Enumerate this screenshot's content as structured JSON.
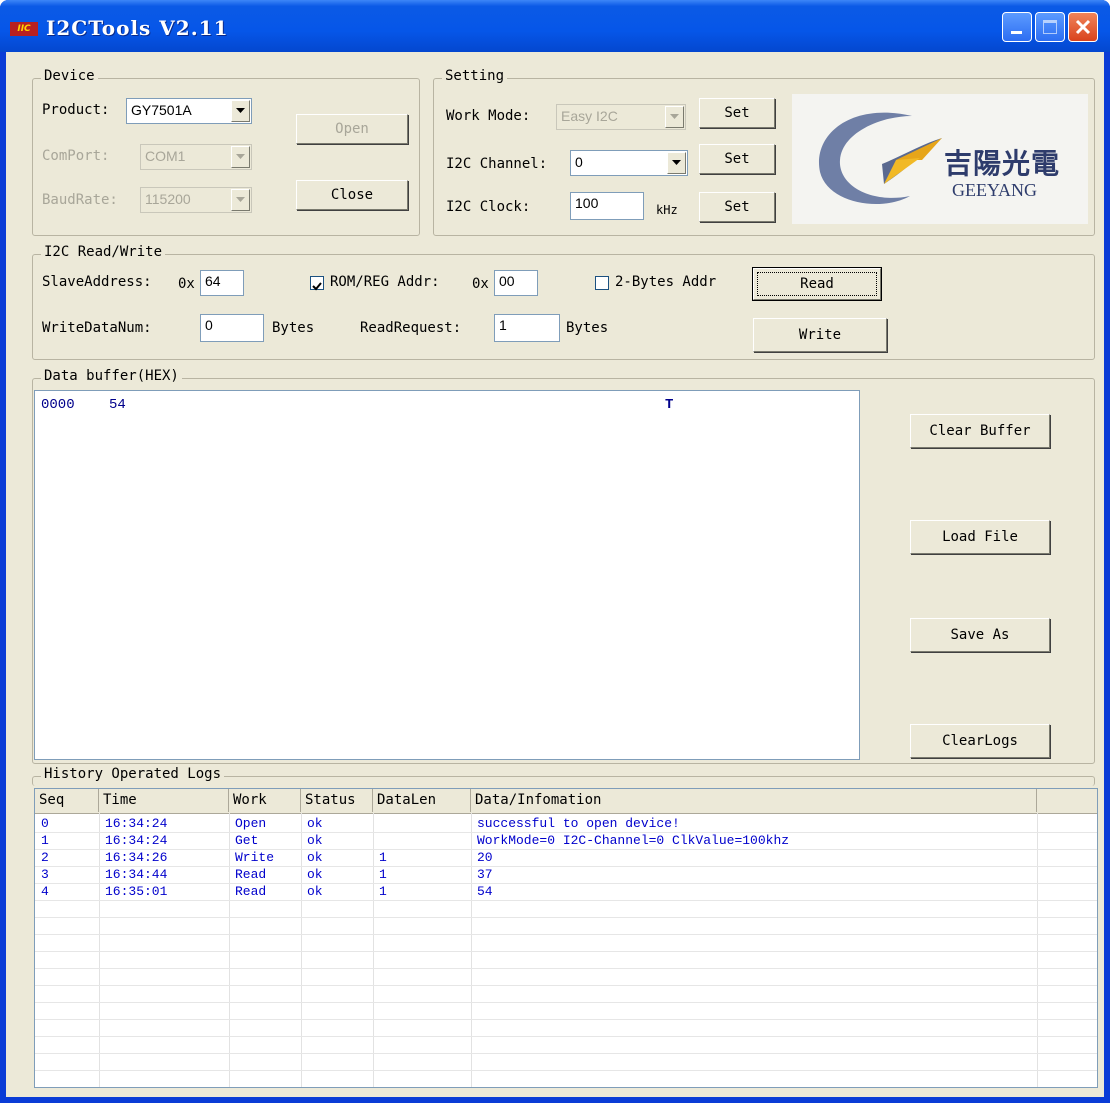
{
  "window": {
    "title": "I2CTools  V2.11",
    "icon_text": "IIC"
  },
  "device": {
    "legend": "Device",
    "product_label": "Product:",
    "product_value": "GY7501A",
    "comport_label": "ComPort:",
    "comport_value": "COM1",
    "baudrate_label": "BaudRate:",
    "baudrate_value": "115200",
    "open_label": "Open",
    "close_label": "Close"
  },
  "setting": {
    "legend": "Setting",
    "workmode_label": "Work Mode:",
    "workmode_value": "Easy I2C",
    "channel_label": "I2C Channel:",
    "channel_value": "0",
    "clock_label": "I2C Clock:",
    "clock_value": "100",
    "clock_unit": "kHz",
    "set_label": "Set"
  },
  "logo": {
    "cn_text": "吉陽光電",
    "en_text": "GEEYANG"
  },
  "rw": {
    "legend": "I2C Read/Write",
    "slave_label": "SlaveAddress:",
    "hex_prefix": "0x",
    "slave_value": "64",
    "romreg_label": "ROM/REG Addr:",
    "romreg_checked": true,
    "romreg_value": "00",
    "twobyte_label": "2-Bytes Addr",
    "twobyte_checked": false,
    "read_label": "Read",
    "write_label": "Write",
    "writenum_label": "WriteDataNum:",
    "writenum_value": "0",
    "bytes_label": "Bytes",
    "readreq_label": "ReadRequest:",
    "readreq_value": "1"
  },
  "buffer": {
    "legend": "Data buffer(HEX)",
    "addr": "0000",
    "hex": "54",
    "ascii": "T",
    "clear_buffer_label": "Clear Buffer",
    "load_file_label": "Load File",
    "save_as_label": "Save As",
    "clear_logs_label": "ClearLogs"
  },
  "logs": {
    "legend": "History Operated Logs",
    "columns": [
      "Seq",
      "Time",
      "Work",
      "Status",
      "DataLen",
      "Data/Infomation"
    ],
    "rows": [
      {
        "seq": "0",
        "time": "16:34:24",
        "work": "Open",
        "status": "ok",
        "len": "",
        "info": "successful to open device!"
      },
      {
        "seq": "1",
        "time": "16:34:24",
        "work": "Get",
        "status": "ok",
        "len": "",
        "info": "WorkMode=0 I2C-Channel=0 ClkValue=100khz"
      },
      {
        "seq": "2",
        "time": "16:34:26",
        "work": "Write",
        "status": "ok",
        "len": "1",
        "info": "20"
      },
      {
        "seq": "3",
        "time": "16:34:44",
        "work": "Read",
        "status": "ok",
        "len": "1",
        "info": "37"
      },
      {
        "seq": "4",
        "time": "16:35:01",
        "work": "Read",
        "status": "ok",
        "len": "1",
        "info": "54"
      }
    ]
  }
}
